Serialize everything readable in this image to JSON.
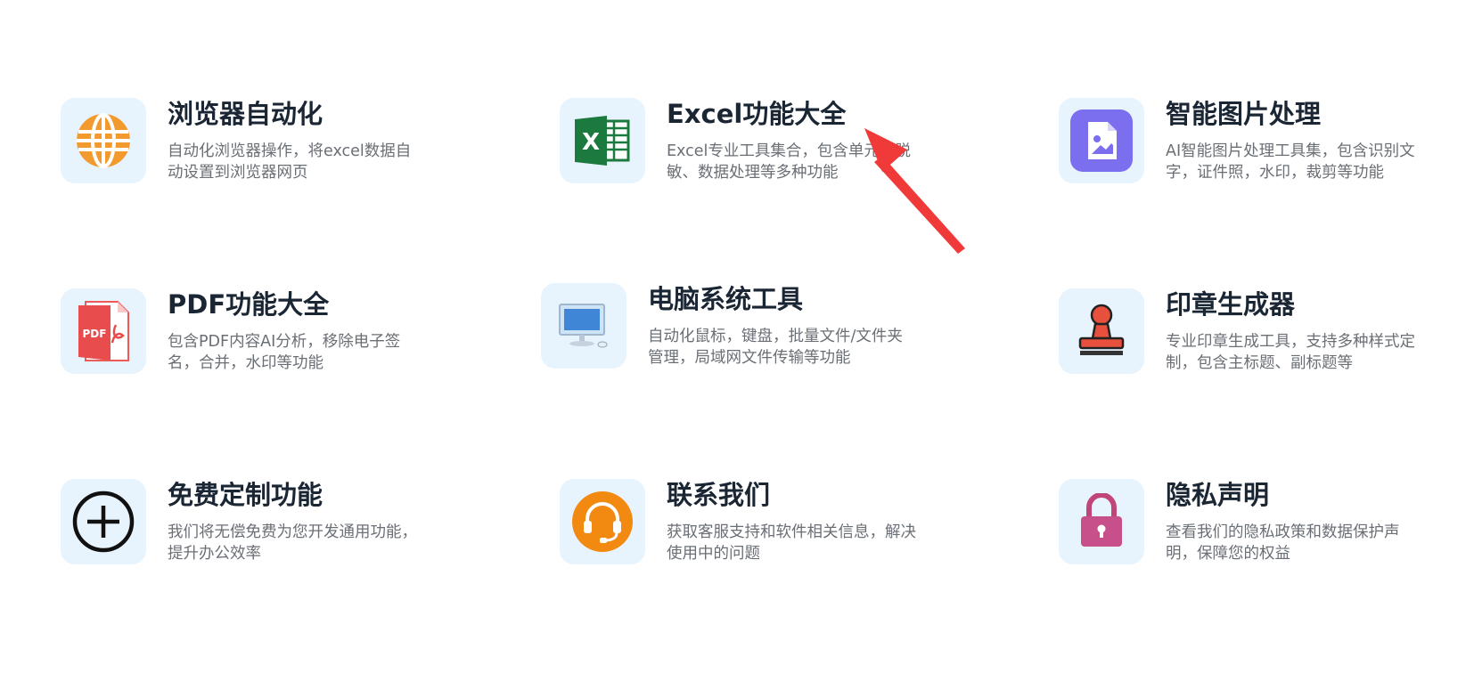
{
  "cards": [
    {
      "title": "浏览器自动化",
      "desc": "自动化浏览器操作，将excel数据自动设置到浏览器网页",
      "icon": "globe-icon"
    },
    {
      "title": "Excel功能大全",
      "desc": "Excel专业工具集合，包含单元格脱敏、数据处理等多种功能",
      "icon": "excel-icon"
    },
    {
      "title": "智能图片处理",
      "desc": "AI智能图片处理工具集，包含识别文字，证件照，水印，裁剪等功能",
      "icon": "image-icon"
    },
    {
      "title": "PDF功能大全",
      "desc": "包含PDF内容AI分析，移除电子签名，合并，水印等功能",
      "icon": "pdf-icon"
    },
    {
      "title": "电脑系统工具",
      "desc": "自动化鼠标，键盘，批量文件/文件夹管理，局域网文件传输等功能",
      "icon": "computer-icon"
    },
    {
      "title": "印章生成器",
      "desc": "专业印章生成工具，支持多种样式定制，包含主标题、副标题等",
      "icon": "stamp-icon"
    },
    {
      "title": "免费定制功能",
      "desc": "我们将无偿免费为您开发通用功能，提升办公效率",
      "icon": "plus-circle-icon"
    },
    {
      "title": "联系我们",
      "desc": "获取客服支持和软件相关信息，解决使用中的问题",
      "icon": "headset-icon"
    },
    {
      "title": "隐私声明",
      "desc": "查看我们的隐私政策和数据保护声明，保障您的权益",
      "icon": "lock-icon"
    }
  ],
  "colors": {
    "icon_bg": "#e8f4fd",
    "title": "#1b2634",
    "desc": "#6a6f76",
    "arrow": "#f03a3a"
  }
}
